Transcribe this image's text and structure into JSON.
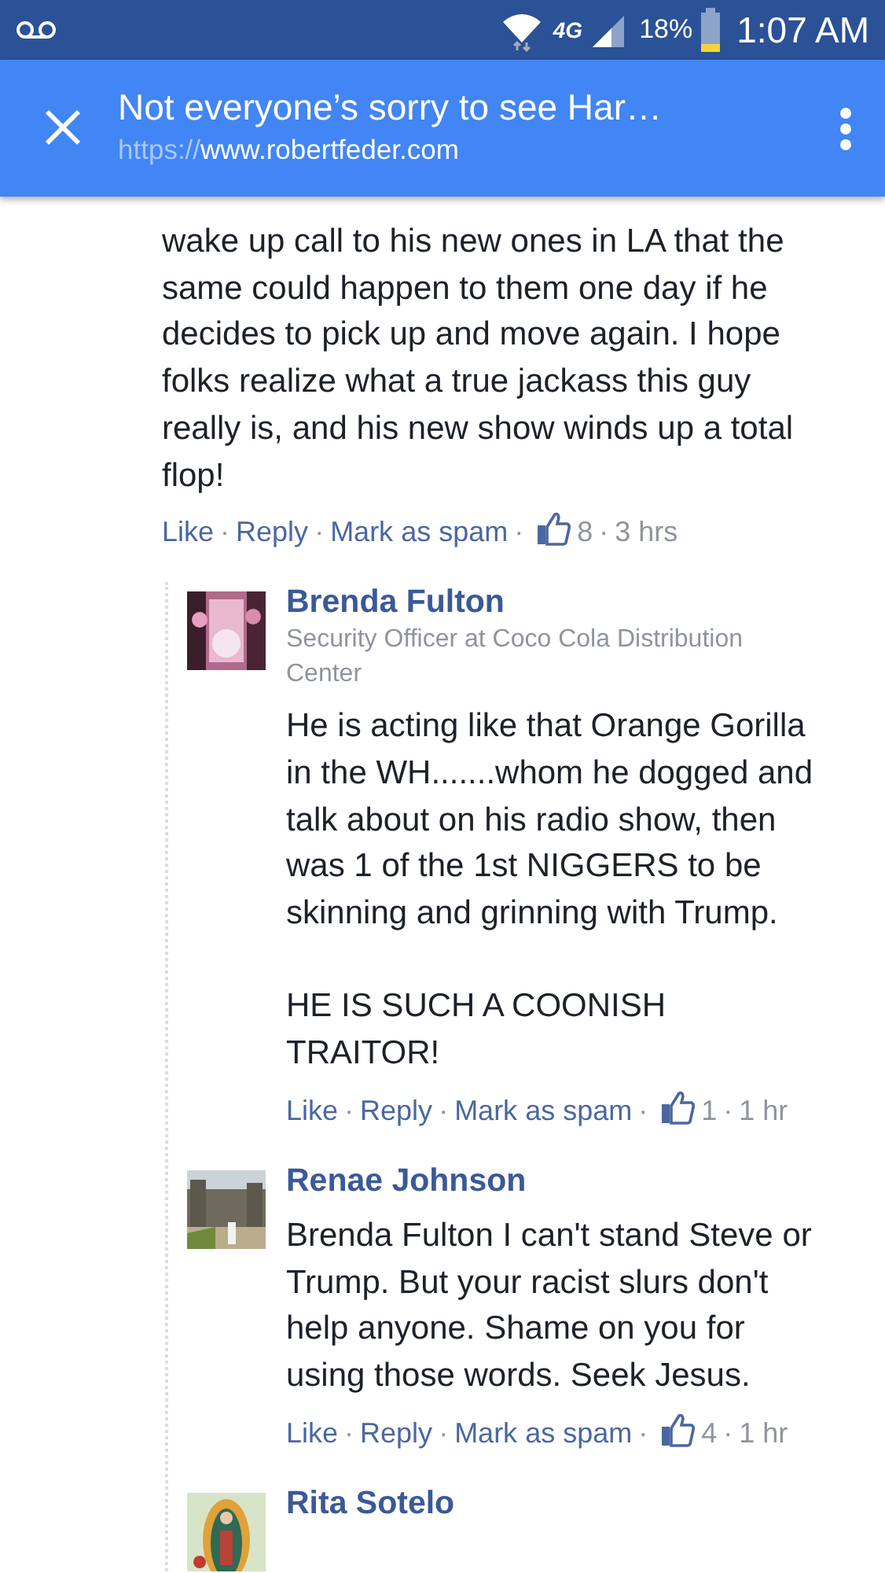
{
  "status_bar": {
    "network": "4G",
    "battery": "18%",
    "time": "1:07 AM"
  },
  "toolbar": {
    "title": "Not everyone’s sorry to see Har…",
    "url_scheme": "https://",
    "url_host": "www.robertfeder.com"
  },
  "separator": "·",
  "comment": {
    "text": "wake up call to his new ones in LA that the same could happen to them one day if he decides to pick up and move again. I hope folks realize what a true jackass this guy really is, and his new show winds up a total flop!",
    "actions": [
      "Like",
      "Reply",
      "Mark as spam"
    ],
    "likes": "8",
    "time": "3 hrs"
  },
  "replies": [
    {
      "author": "Brenda Fulton",
      "subtitle": "Security Officer at Coco Cola Distribution Center",
      "text": "He is acting like that Orange Gorilla in the WH.......whom he dogged and talk about on his radio show, then was 1 of the 1st NIGGERS to be skinning and grinning with Trump.\n\nHE IS SUCH A COONISH TRAITOR!",
      "actions": [
        "Like",
        "Reply",
        "Mark as spam"
      ],
      "likes": "1",
      "time": "1 hr"
    },
    {
      "author": "Renae Johnson",
      "text": "Brenda Fulton I can't stand Steve or Trump. But your racist slurs don't help anyone. Shame on you for using those words. Seek Jesus.",
      "actions": [
        "Like",
        "Reply",
        "Mark as spam"
      ],
      "likes": "4",
      "time": "1 hr"
    },
    {
      "author": "Rita Sotelo"
    }
  ]
}
